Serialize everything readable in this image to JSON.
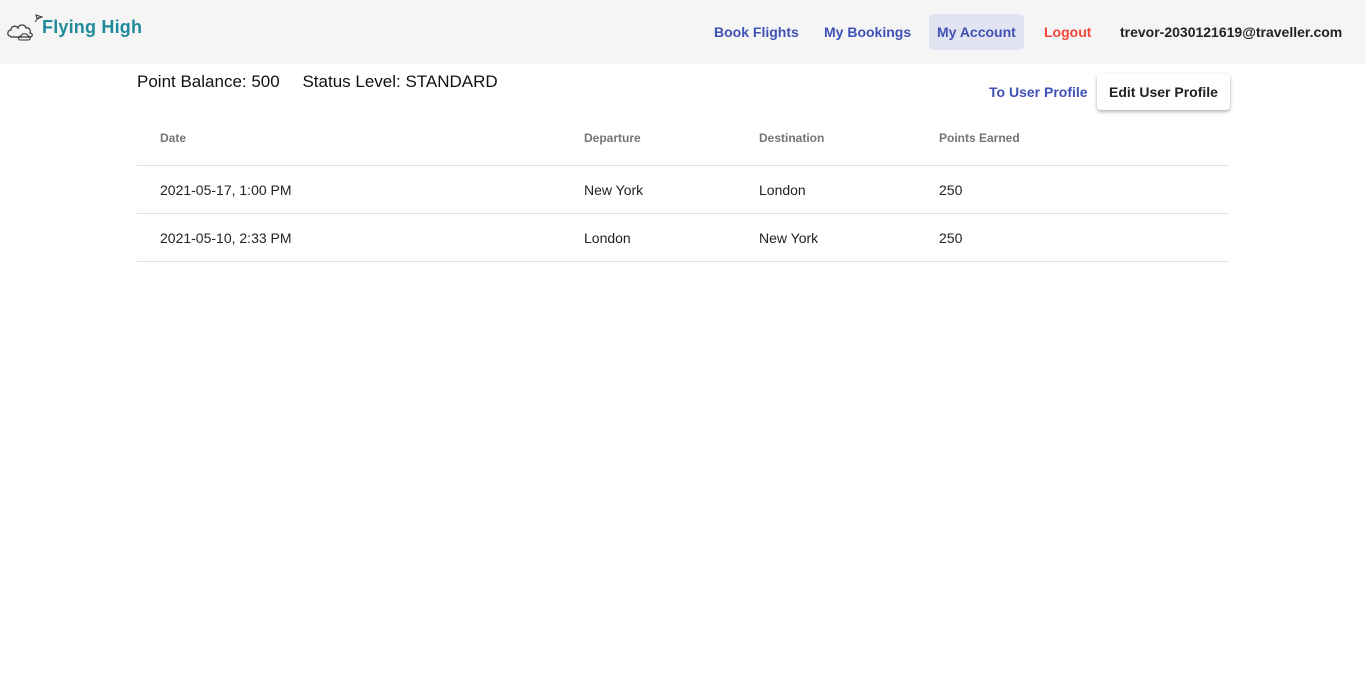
{
  "brand": {
    "name": "Flying High",
    "logo_icon": "cloud-plane-icon",
    "color": "#1f8a9c"
  },
  "nav": {
    "book_flights": "Book Flights",
    "my_bookings": "My Bookings",
    "my_account": "My Account",
    "logout": "Logout",
    "user_email": "trevor-2030121619@traveller.com",
    "active": "My Account",
    "accent_color": "#3f51b5",
    "logout_color": "#f44336"
  },
  "account": {
    "point_balance": "Point Balance: 500",
    "status_level": "Status Level: STANDARD",
    "to_user_profile": "To User Profile",
    "edit_user_profile": "Edit User Profile"
  },
  "table": {
    "headers": [
      "Date",
      "Departure",
      "Destination",
      "Points Earned"
    ],
    "rows": [
      [
        "2021-05-17, 1:00 PM",
        "New York",
        "London",
        "250"
      ],
      [
        "2021-05-10, 2:33 PM",
        "London",
        "New York",
        "250"
      ]
    ]
  }
}
